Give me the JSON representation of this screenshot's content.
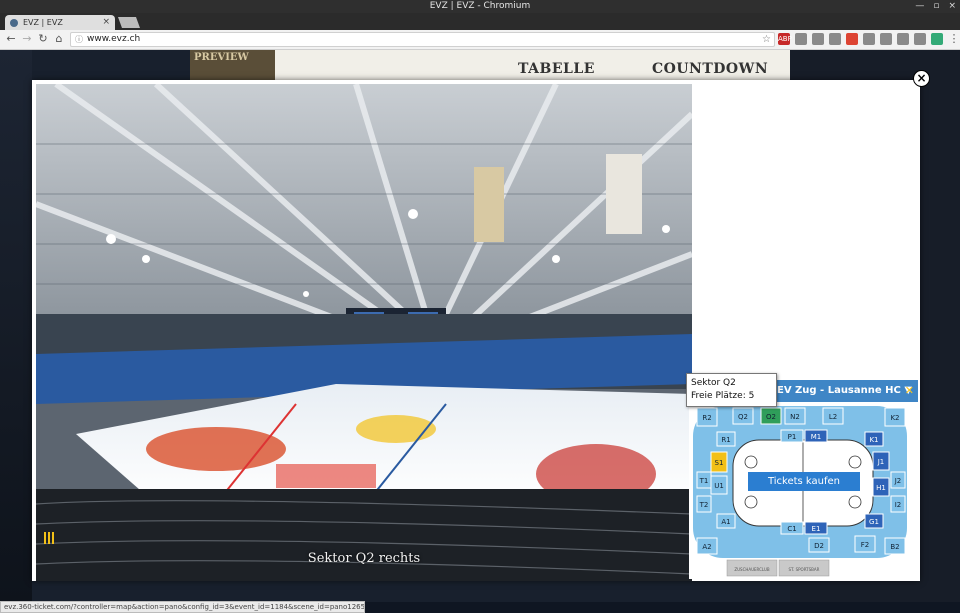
{
  "window": {
    "title": "EVZ | EVZ - Chromium"
  },
  "tab": {
    "title": "EVZ | EVZ",
    "close": "×"
  },
  "toolbar": {
    "back": "←",
    "forward": "→",
    "reload": "↻",
    "home": "⌂",
    "url": "www.evz.ch",
    "info": "ⓘ",
    "star": "☆"
  },
  "extensions": [
    "ABP",
    "ext",
    "ext",
    "ext",
    "ext",
    "ext",
    "ext",
    "ext",
    "ext",
    "ext",
    "ext",
    "⋮"
  ],
  "background_page": {
    "preview": "PREVIEW",
    "nav": [
      "TABELLE",
      "COUNTDOWN"
    ]
  },
  "modal": {
    "close": "×",
    "caption": "Sektor Q2 rechts"
  },
  "map": {
    "header": "EV Zug - Lausanne HC ▼",
    "close": "✕",
    "tooltip": {
      "sector": "Sektor Q2",
      "seats": "Freie Plätze: 5"
    },
    "buy_button": "Tickets kaufen",
    "sectors": [
      "R2",
      "Q2",
      "O2",
      "N2",
      "L2",
      "K2",
      "R1",
      "P1",
      "M1",
      "K1",
      "S1",
      "J1",
      "T1",
      "J2",
      "U1",
      "H1",
      "T2",
      "I2",
      "A1",
      "G1",
      "A2",
      "C1",
      "E1",
      "F2",
      "B2",
      "D2"
    ],
    "facilities": [
      "ZUSCHAUERCLUB",
      "ST. SPORTSBAR"
    ]
  },
  "status": "evz.360-ticket.com/?controller=map&action=pano&config_id=3&event_id=1184&scene_id=pano1265#",
  "colors": {
    "map_header": "#3f86c6",
    "seat_light": "#7fc0e8",
    "seat_dark": "#2e63b8",
    "selected": "#2f9e5a",
    "highlight": "#f2c018"
  }
}
